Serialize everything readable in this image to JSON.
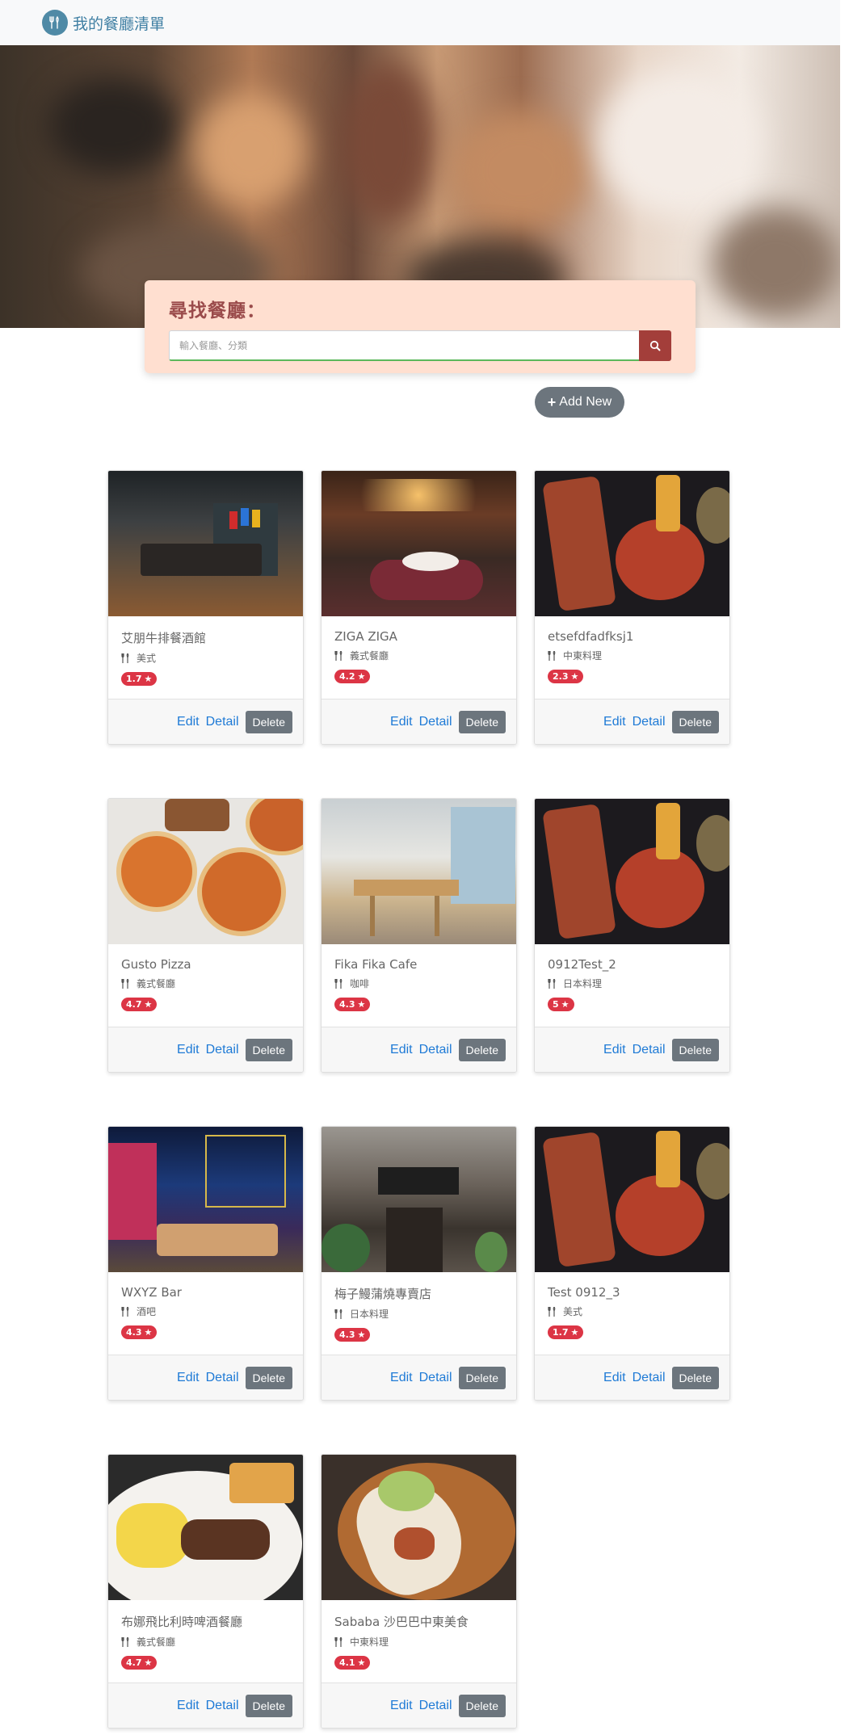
{
  "navbar": {
    "brand": "我的餐廳清單"
  },
  "search": {
    "title": "尋找餐廳：",
    "placeholder": "輸入餐廳、分類"
  },
  "actions": {
    "add_new": "Add New"
  },
  "card_actions": {
    "edit": "Edit",
    "detail": "Detail",
    "delete": "Delete"
  },
  "restaurants": [
    {
      "name": "艾朋牛排餐酒館",
      "category": "美式",
      "rating": "1.7"
    },
    {
      "name": "ZIGA ZIGA",
      "category": "義式餐廳",
      "rating": "4.2"
    },
    {
      "name": "etsefdfadfksj1",
      "category": "中東料理",
      "rating": "2.3"
    },
    {
      "name": "Gusto Pizza",
      "category": "義式餐廳",
      "rating": "4.7"
    },
    {
      "name": "Fika Fika Cafe",
      "category": "咖啡",
      "rating": "4.3"
    },
    {
      "name": "0912Test_2",
      "category": "日本料理",
      "rating": "5"
    },
    {
      "name": "WXYZ Bar",
      "category": "酒吧",
      "rating": "4.3"
    },
    {
      "name": "梅子鰻蒲燒專賣店",
      "category": "日本料理",
      "rating": "4.3"
    },
    {
      "name": "Test 0912_3",
      "category": "美式",
      "rating": "1.7"
    },
    {
      "name": "布娜飛比利時啤酒餐廳",
      "category": "義式餐廳",
      "rating": "4.7"
    },
    {
      "name": "Sababa 沙巴巴中東美食",
      "category": "中東料理",
      "rating": "4.1"
    }
  ],
  "colors": {
    "brand": "#3f7fa3",
    "search_panel": "#ffdfd0",
    "search_button": "#a33e3a",
    "badge": "#dc3545",
    "link": "#1e7ad6",
    "secondary": "#6c757d"
  },
  "icons": {
    "brand": "utensils-icon",
    "search": "search-icon",
    "add": "plus-icon",
    "category": "utensils-icon",
    "rating": "star-icon"
  }
}
